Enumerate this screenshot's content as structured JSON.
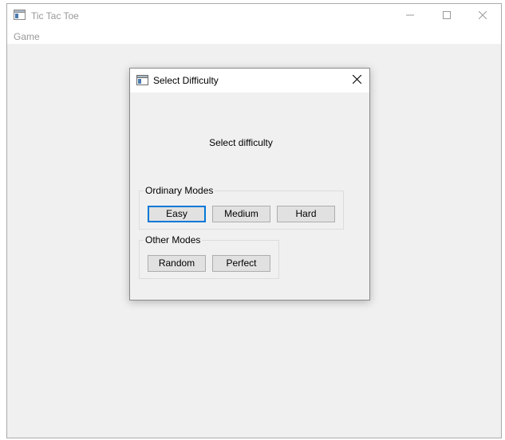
{
  "main_window": {
    "title": "Tic Tac Toe",
    "icon": "app-window-icon",
    "menu": [
      "Game"
    ],
    "controls": [
      "minimize-icon",
      "maximize-icon",
      "close-icon"
    ]
  },
  "dialog": {
    "title": "Select Difficulty",
    "icon": "app-window-icon",
    "prompt": "Select difficulty",
    "groups": {
      "ordinary": {
        "title": "Ordinary Modes",
        "buttons": [
          "Easy",
          "Medium",
          "Hard"
        ]
      },
      "other": {
        "title": "Other Modes",
        "buttons": [
          "Random",
          "Perfect"
        ]
      }
    },
    "default_button": "Easy"
  },
  "colors": {
    "focus_border": "#0078d7",
    "window_bg": "#f0f0f0",
    "inactive_text": "#999999"
  }
}
